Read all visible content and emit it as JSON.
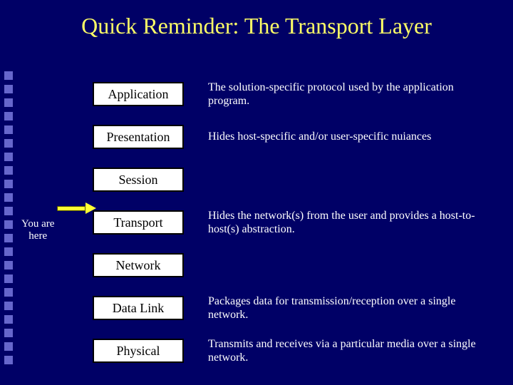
{
  "title": "Quick Reminder: The Transport Layer",
  "pointer": {
    "line1": "You are",
    "line2": "here"
  },
  "layers": [
    {
      "name": "Application",
      "desc": "The solution-specific protocol used by the application program."
    },
    {
      "name": "Presentation",
      "desc": "Hides host-specific and/or user-specific nuiances"
    },
    {
      "name": "Session",
      "desc": ""
    },
    {
      "name": "Transport",
      "desc": "Hides the network(s) from the user and provides a host-to-host(s) abstraction."
    },
    {
      "name": "Network",
      "desc": ""
    },
    {
      "name": "Data Link",
      "desc": "Packages data for transmission/reception over a single network."
    },
    {
      "name": "Physical",
      "desc": "Transmits and receives via a particular media over a single network."
    }
  ]
}
